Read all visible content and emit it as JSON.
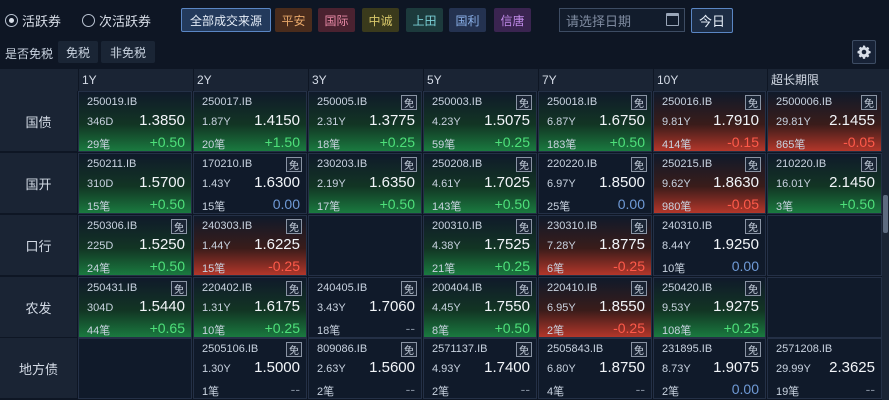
{
  "filters": {
    "radio_active": "活跃券",
    "radio_secondary": "次活跃券",
    "all_sources": "全部成交来源",
    "sources": [
      {
        "label": "平安",
        "bg": "#4a2c1c",
        "color": "#e8a86a"
      },
      {
        "label": "国际",
        "bg": "#4a2230",
        "color": "#e88aa6"
      },
      {
        "label": "中诚",
        "bg": "#3a3a1c",
        "color": "#d8c86a"
      },
      {
        "label": "上田",
        "bg": "#1c3a3c",
        "color": "#7ad0d6"
      },
      {
        "label": "国利",
        "bg": "#243250",
        "color": "#8ab0e8"
      },
      {
        "label": "信唐",
        "bg": "#3a2450",
        "color": "#c08ae8"
      }
    ],
    "date_placeholder": "请选择日期",
    "today": "今日"
  },
  "tax": {
    "label": "是否免税",
    "options": [
      "免税",
      "非免税"
    ]
  },
  "columns": [
    "1Y",
    "2Y",
    "3Y",
    "5Y",
    "7Y",
    "10Y",
    "超长期限"
  ],
  "rows": [
    {
      "name": "国债",
      "cells": [
        {
          "code": "250019.IB",
          "free": false,
          "term": "346D",
          "price": "1.3850",
          "count": "29笔",
          "change": "+0.50",
          "trend": "up"
        },
        {
          "code": "250017.IB",
          "free": false,
          "term": "1.87Y",
          "price": "1.4150",
          "count": "20笔",
          "change": "+1.50",
          "trend": "up"
        },
        {
          "code": "250005.IB",
          "free": true,
          "term": "2.31Y",
          "price": "1.3775",
          "count": "18笔",
          "change": "+0.25",
          "trend": "up"
        },
        {
          "code": "250003.IB",
          "free": true,
          "term": "4.23Y",
          "price": "1.5075",
          "count": "59笔",
          "change": "+0.25",
          "trend": "up"
        },
        {
          "code": "250018.IB",
          "free": true,
          "term": "6.87Y",
          "price": "1.6750",
          "count": "183笔",
          "change": "+0.50",
          "trend": "up"
        },
        {
          "code": "250016.IB",
          "free": true,
          "term": "9.81Y",
          "price": "1.7910",
          "count": "414笔",
          "change": "-0.15",
          "trend": "down"
        },
        {
          "code": "2500006.IB",
          "free": true,
          "term": "29.81Y",
          "price": "2.1455",
          "count": "865笔",
          "change": "-0.05",
          "trend": "down"
        }
      ]
    },
    {
      "name": "国开",
      "cells": [
        {
          "code": "250211.IB",
          "free": false,
          "term": "310D",
          "price": "1.5700",
          "count": "15笔",
          "change": "+0.50",
          "trend": "up"
        },
        {
          "code": "170210.IB",
          "free": true,
          "term": "1.43Y",
          "price": "1.6300",
          "count": "15笔",
          "change": "0.00",
          "trend": "flat"
        },
        {
          "code": "230203.IB",
          "free": true,
          "term": "2.19Y",
          "price": "1.6350",
          "count": "17笔",
          "change": "+0.50",
          "trend": "up"
        },
        {
          "code": "250208.IB",
          "free": true,
          "term": "4.61Y",
          "price": "1.7025",
          "count": "143笔",
          "change": "+0.50",
          "trend": "up"
        },
        {
          "code": "220220.IB",
          "free": true,
          "term": "6.97Y",
          "price": "1.8500",
          "count": "25笔",
          "change": "0.00",
          "trend": "flat"
        },
        {
          "code": "250215.IB",
          "free": true,
          "term": "9.62Y",
          "price": "1.8630",
          "count": "980笔",
          "change": "-0.05",
          "trend": "down"
        },
        {
          "code": "210220.IB",
          "free": true,
          "term": "16.01Y",
          "price": "2.1450",
          "count": "3笔",
          "change": "+0.50",
          "trend": "up"
        }
      ]
    },
    {
      "name": "口行",
      "cells": [
        {
          "code": "250306.IB",
          "free": true,
          "term": "225D",
          "price": "1.5250",
          "count": "24笔",
          "change": "+0.50",
          "trend": "up"
        },
        {
          "code": "240303.IB",
          "free": true,
          "term": "1.44Y",
          "price": "1.6225",
          "count": "15笔",
          "change": "-0.25",
          "trend": "down"
        },
        null,
        {
          "code": "200310.IB",
          "free": true,
          "term": "4.38Y",
          "price": "1.7525",
          "count": "21笔",
          "change": "+0.25",
          "trend": "up"
        },
        {
          "code": "230310.IB",
          "free": true,
          "term": "7.28Y",
          "price": "1.8775",
          "count": "6笔",
          "change": "-0.25",
          "trend": "down"
        },
        {
          "code": "240310.IB",
          "free": true,
          "term": "8.44Y",
          "price": "1.9250",
          "count": "10笔",
          "change": "0.00",
          "trend": "flat"
        },
        null
      ]
    },
    {
      "name": "农发",
      "cells": [
        {
          "code": "250431.IB",
          "free": true,
          "term": "304D",
          "price": "1.5440",
          "count": "44笔",
          "change": "+0.65",
          "trend": "up"
        },
        {
          "code": "220402.IB",
          "free": true,
          "term": "1.31Y",
          "price": "1.6175",
          "count": "10笔",
          "change": "+0.25",
          "trend": "up"
        },
        {
          "code": "240405.IB",
          "free": true,
          "term": "3.43Y",
          "price": "1.7060",
          "count": "18笔",
          "change": "--",
          "trend": "none"
        },
        {
          "code": "200404.IB",
          "free": true,
          "term": "4.45Y",
          "price": "1.7550",
          "count": "8笔",
          "change": "+0.50",
          "trend": "up"
        },
        {
          "code": "220410.IB",
          "free": true,
          "term": "6.95Y",
          "price": "1.8550",
          "count": "2笔",
          "change": "-0.25",
          "trend": "down"
        },
        {
          "code": "250420.IB",
          "free": true,
          "term": "9.53Y",
          "price": "1.9275",
          "count": "108笔",
          "change": "+0.25",
          "trend": "up"
        },
        null
      ]
    },
    {
      "name": "地方债",
      "cells": [
        null,
        {
          "code": "2505106.IB",
          "free": true,
          "term": "1.30Y",
          "price": "1.5000",
          "count": "1笔",
          "change": "--",
          "trend": "none"
        },
        {
          "code": "809086.IB",
          "free": true,
          "term": "2.63Y",
          "price": "1.5600",
          "count": "2笔",
          "change": "--",
          "trend": "none"
        },
        {
          "code": "2571137.IB",
          "free": true,
          "term": "4.93Y",
          "price": "1.7400",
          "count": "2笔",
          "change": "--",
          "trend": "none"
        },
        {
          "code": "2505843.IB",
          "free": true,
          "term": "6.80Y",
          "price": "1.8750",
          "count": "4笔",
          "change": "--",
          "trend": "none"
        },
        {
          "code": "231895.IB",
          "free": true,
          "term": "8.73Y",
          "price": "1.9075",
          "count": "2笔",
          "change": "0.00",
          "trend": "flat"
        },
        {
          "code": "2571208.IB",
          "free": false,
          "term": "29.99Y",
          "price": "2.3625",
          "count": "19笔",
          "change": "--",
          "trend": "none"
        }
      ]
    }
  ],
  "free_badge": "免"
}
